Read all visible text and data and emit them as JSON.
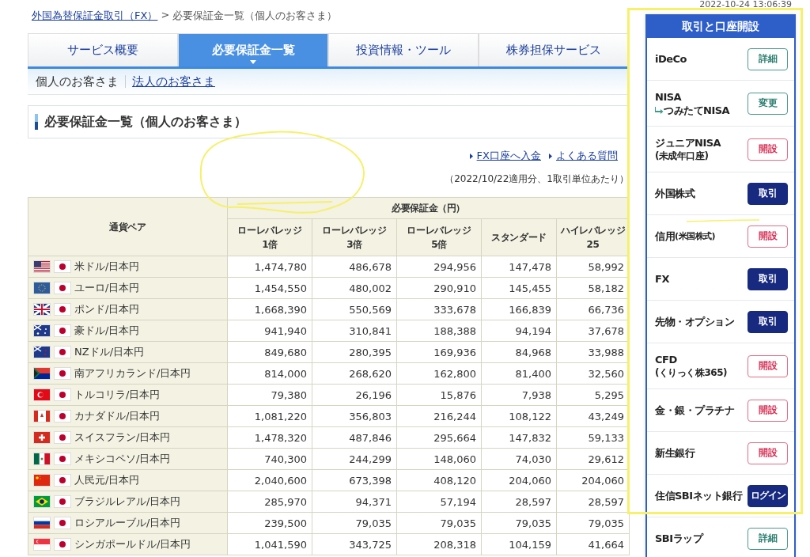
{
  "breadcrumb": {
    "link": "外国為替保証金取引（FX）",
    "separator": ">",
    "current": "必要保証金一覧（個人のお客さま）"
  },
  "tabs": [
    {
      "label": "サービス概要",
      "selected": false
    },
    {
      "label": "必要保証金一覧",
      "selected": true
    },
    {
      "label": "投資情報・ツール",
      "selected": false
    },
    {
      "label": "株券担保サービス",
      "selected": false
    }
  ],
  "subnav": [
    {
      "label": "個人のお客さま",
      "selected": true
    },
    {
      "label": "法人のお客さま",
      "selected": false
    }
  ],
  "heading": "必要保証金一覧（個人のお客さま）",
  "links": [
    "FX口座へ入金",
    "よくある質問"
  ],
  "note": "（2022/10/22適用分、1取引単位あたり）",
  "table": {
    "pair_header": "通貨ペア",
    "group_header": "必要保証金（円）",
    "columns": [
      [
        "ローレバレッジ",
        "1倍"
      ],
      [
        "ローレバレッジ",
        "3倍"
      ],
      [
        "ローレバレッジ",
        "5倍"
      ],
      [
        "スタンダード"
      ],
      [
        "ハイレバレッジ",
        "25"
      ]
    ],
    "rows": [
      {
        "pair": "米ドル/日本円",
        "values": [
          "1,474,780",
          "486,678",
          "294,956",
          "147,478",
          "58,992"
        ]
      },
      {
        "pair": "ユーロ/日本円",
        "values": [
          "1,454,550",
          "480,002",
          "290,910",
          "145,455",
          "58,182"
        ]
      },
      {
        "pair": "ポンド/日本円",
        "values": [
          "1,668,390",
          "550,569",
          "333,678",
          "166,839",
          "66,736"
        ]
      },
      {
        "pair": "豪ドル/日本円",
        "values": [
          "941,940",
          "310,841",
          "188,388",
          "94,194",
          "37,678"
        ]
      },
      {
        "pair": "NZドル/日本円",
        "values": [
          "849,680",
          "280,395",
          "169,936",
          "84,968",
          "33,988"
        ]
      },
      {
        "pair": "南アフリカランド/日本円",
        "values": [
          "814,000",
          "268,620",
          "162,800",
          "81,400",
          "32,560"
        ]
      },
      {
        "pair": "トルコリラ/日本円",
        "values": [
          "79,380",
          "26,196",
          "15,876",
          "7,938",
          "5,295"
        ]
      },
      {
        "pair": "カナダドル/日本円",
        "values": [
          "1,081,220",
          "356,803",
          "216,244",
          "108,122",
          "43,249"
        ]
      },
      {
        "pair": "スイスフラン/日本円",
        "values": [
          "1,478,320",
          "487,846",
          "295,664",
          "147,832",
          "59,133"
        ]
      },
      {
        "pair": "メキシコペソ/日本円",
        "values": [
          "740,300",
          "244,299",
          "148,060",
          "74,030",
          "29,612"
        ]
      },
      {
        "pair": "人民元/日本円",
        "values": [
          "2,040,600",
          "673,398",
          "408,120",
          "204,060",
          "204,060"
        ]
      },
      {
        "pair": "ブラジルレアル/日本円",
        "values": [
          "285,970",
          "94,371",
          "57,194",
          "28,597",
          "28,597"
        ]
      },
      {
        "pair": "ロシアルーブル/日本円",
        "values": [
          "239,500",
          "79,035",
          "79,035",
          "79,035",
          "79,035"
        ]
      },
      {
        "pair": "シンガポールドル/日本円",
        "values": [
          "1,041,590",
          "343,725",
          "208,318",
          "104,159",
          "41,664"
        ]
      }
    ]
  },
  "timestamp": "2022-10-24 13:06:39",
  "sidebar": {
    "title": "取引と口座開設",
    "items": [
      {
        "label": "iDeCo",
        "button": {
          "label": "詳細",
          "kind": "detail"
        }
      },
      {
        "label": "NISA",
        "sub": "つみたてNISA",
        "sub_arrow": true,
        "button": {
          "label": "変更",
          "kind": "detail"
        }
      },
      {
        "label": "ジュニアNISA",
        "sub": "(未成年口座)",
        "button": {
          "label": "開設",
          "kind": "open"
        }
      },
      {
        "label": "外国株式",
        "button": {
          "label": "取引",
          "kind": "trade"
        }
      },
      {
        "label": "信用",
        "inline_sub": "(米国株式)",
        "button": {
          "label": "開設",
          "kind": "open"
        }
      },
      {
        "label": "FX",
        "button": {
          "label": "取引",
          "kind": "trade"
        }
      },
      {
        "label": "先物・オプション",
        "button": {
          "label": "取引",
          "kind": "trade"
        }
      },
      {
        "label": "CFD",
        "sub": "(くりっく株365)",
        "button": {
          "label": "開設",
          "kind": "open"
        }
      },
      {
        "label": "金・銀・プラチナ",
        "button": {
          "label": "開設",
          "kind": "open"
        }
      },
      {
        "label": "新生銀行",
        "button": {
          "label": "開設",
          "kind": "open"
        }
      },
      {
        "label": "住信SBIネット銀行",
        "button": {
          "label": "ログイン",
          "kind": "trade"
        }
      },
      {
        "label": "SBIラップ",
        "button": {
          "label": "詳細",
          "kind": "detail"
        }
      }
    ]
  }
}
